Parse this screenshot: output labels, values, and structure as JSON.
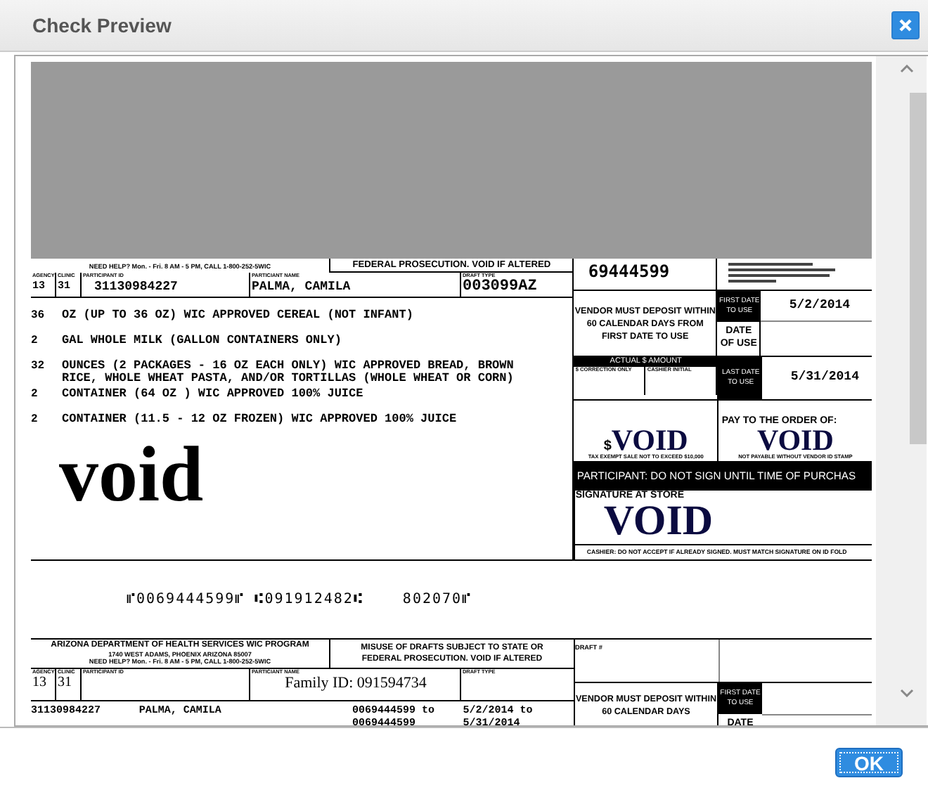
{
  "dialog": {
    "title": "Check Preview"
  },
  "check": {
    "help_line": "NEED HELP? Mon. - Fri. 8 AM - 5 PM, CALL 1-800-252-5WIC",
    "warning": "FEDERAL PROSECUTION.  VOID IF ALTERED",
    "fields": [
      {
        "label": "AGENCY",
        "value": "13"
      },
      {
        "label": "CLINIC",
        "value": "31"
      },
      {
        "label": "PARTICIPANT ID",
        "value": "31130984227"
      },
      {
        "label": "PARTICIANT NAME",
        "value": "PALMA, CAMILA"
      },
      {
        "label": "DRAFT TYPE",
        "value": "003099AZ"
      }
    ],
    "items": [
      {
        "qty": "36",
        "text": "OZ (UP TO 36 OZ) WIC APPROVED CEREAL (NOT INFANT)"
      },
      {
        "qty": "2",
        "text": "GAL  WHOLE MILK (GALLON CONTAINERS ONLY)"
      },
      {
        "qty": "32",
        "text": "OUNCES (2 PACKAGES - 16 OZ EACH ONLY) WIC APPROVED BREAD, BROWN RICE, WHOLE WHEAT PASTA, AND/OR TORTILLAS (WHOLE WHEAT OR CORN)"
      },
      {
        "qty": "2",
        "text": "CONTAINER (64 OZ ) WIC APPROVED 100% JUICE"
      },
      {
        "qty": "2",
        "text": "CONTAINER (11.5 - 12 OZ FROZEN) WIC APPROVED 100% JUICE"
      }
    ],
    "void_stamp": "void",
    "draft_number": "69444599",
    "vendor_notice": "VENDOR MUST DEPOSIT WITHIN 60 CALENDAR DAYS FROM FIRST DATE TO USE",
    "first_date_label": "FIRST DATE TO USE",
    "first_date": "5/2/2014",
    "date_of_use_label": "DATE OF USE",
    "amount_label": "ACTUAL $ AMOUNT",
    "amount_sublabels": [
      "$ CORRECTION ONLY",
      "CASHIER INITIAL"
    ],
    "last_date_label": "LAST DATE TO USE",
    "last_date": "5/31/2014",
    "dollar_sign": "$",
    "amount_value": "VOID",
    "amount_note": "TAX EXEMPT SALE NOT TO EXCEED $10,000",
    "pay_to_label": "PAY TO THE ORDER OF:",
    "payee": "VOID",
    "payee_note": "NOT PAYABLE WITHOUT VENDOR ID STAMP",
    "participant_notice": "PARTICIPANT: DO NOT SIGN UNTIL TIME OF PURCHAS",
    "signature_label": "SIGNATURE AT STORE",
    "signature": "VOID",
    "cashier_notice": "CASHIER: DO NOT ACCEPT IF ALREADY SIGNED.  MUST MATCH SIGNATURE ON ID FOLD",
    "micr": [
      "⑈0069444599⑈ ⑆091912482⑆",
      "802070⑈"
    ]
  },
  "stub": {
    "header": [
      "ARIZONA DEPARTMENT OF HEALTH SERVICES WIC PROGRAM",
      "1740 WEST ADAMS, PHOENIX ARIZONA 85007",
      "NEED HELP? Mon. - Fri. 8 AM - 5 PM, CALL 1-800-252-5WIC"
    ],
    "warning": [
      "MISUSE OF DRAFTS SUBJECT TO STATE OR",
      "FEDERAL PROSECUTION.  VOID IF ALTERED"
    ],
    "fields": [
      {
        "label": "AGENCY",
        "value": "13"
      },
      {
        "label": "CLINIC",
        "value": "31"
      },
      {
        "label": "PARTICIPANT ID"
      },
      {
        "label": "PARTICIANT NAME",
        "value": "Family ID: 091594734"
      },
      {
        "label": "DRAFT TYPE"
      }
    ],
    "participant_id": "31130984227",
    "participant_name": "PALMA, CAMILA",
    "draft_range": [
      "0069444599 to",
      "0069444599"
    ],
    "date_range": [
      "5/2/2014 to",
      "5/31/2014"
    ],
    "draft_label": "DRAFT #",
    "vendor_notice": "VENDOR MUST DEPOSIT WITHIN 60 CALENDAR DAYS",
    "first_date_label": "FIRST DATE TO USE",
    "date_label": "DATE"
  },
  "buttons": [
    {
      "label": "OK"
    }
  ]
}
